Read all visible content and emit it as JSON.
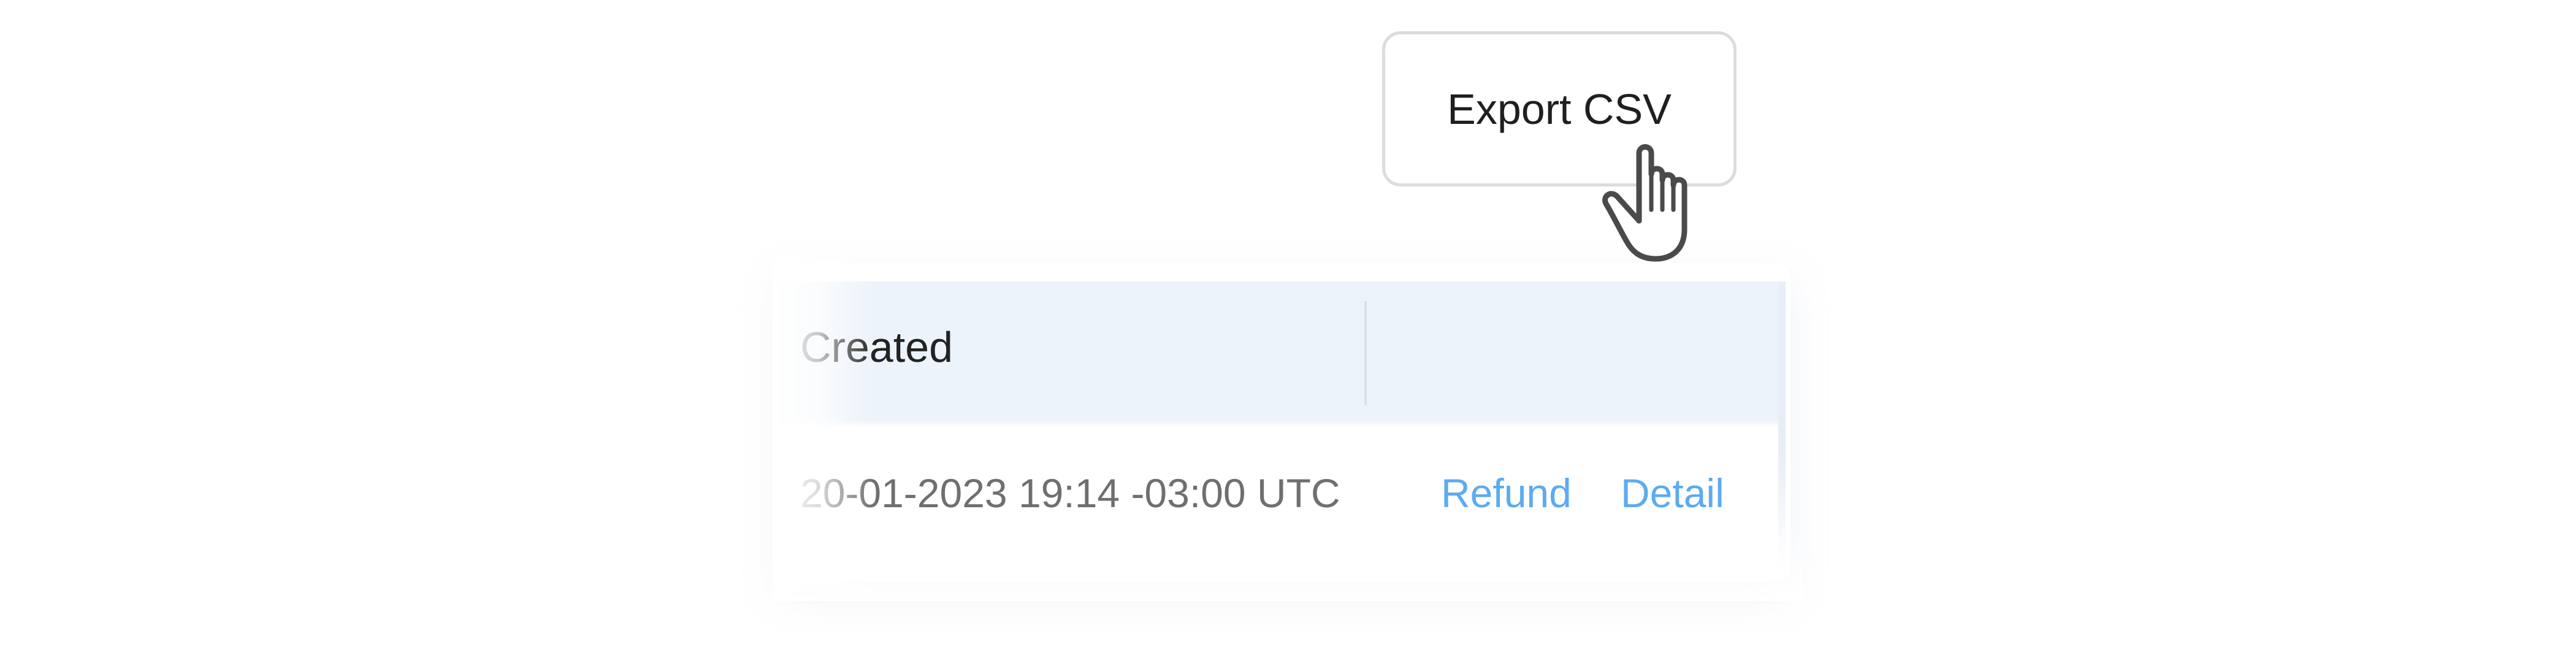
{
  "toolbar": {
    "export_label": "Export CSV"
  },
  "table": {
    "headers": {
      "created": "Created",
      "actions": ""
    },
    "rows": [
      {
        "created": "20-01-2023 19:14 -03:00 UTC",
        "actions": {
          "refund_label": "Refund",
          "detail_label": "Detail"
        }
      }
    ]
  },
  "cursor": {
    "icon": "hand-pointer-icon"
  },
  "colors": {
    "link": "#5cabf0",
    "header_bg": "#edf3fa",
    "button_border": "#dcdcdc"
  }
}
